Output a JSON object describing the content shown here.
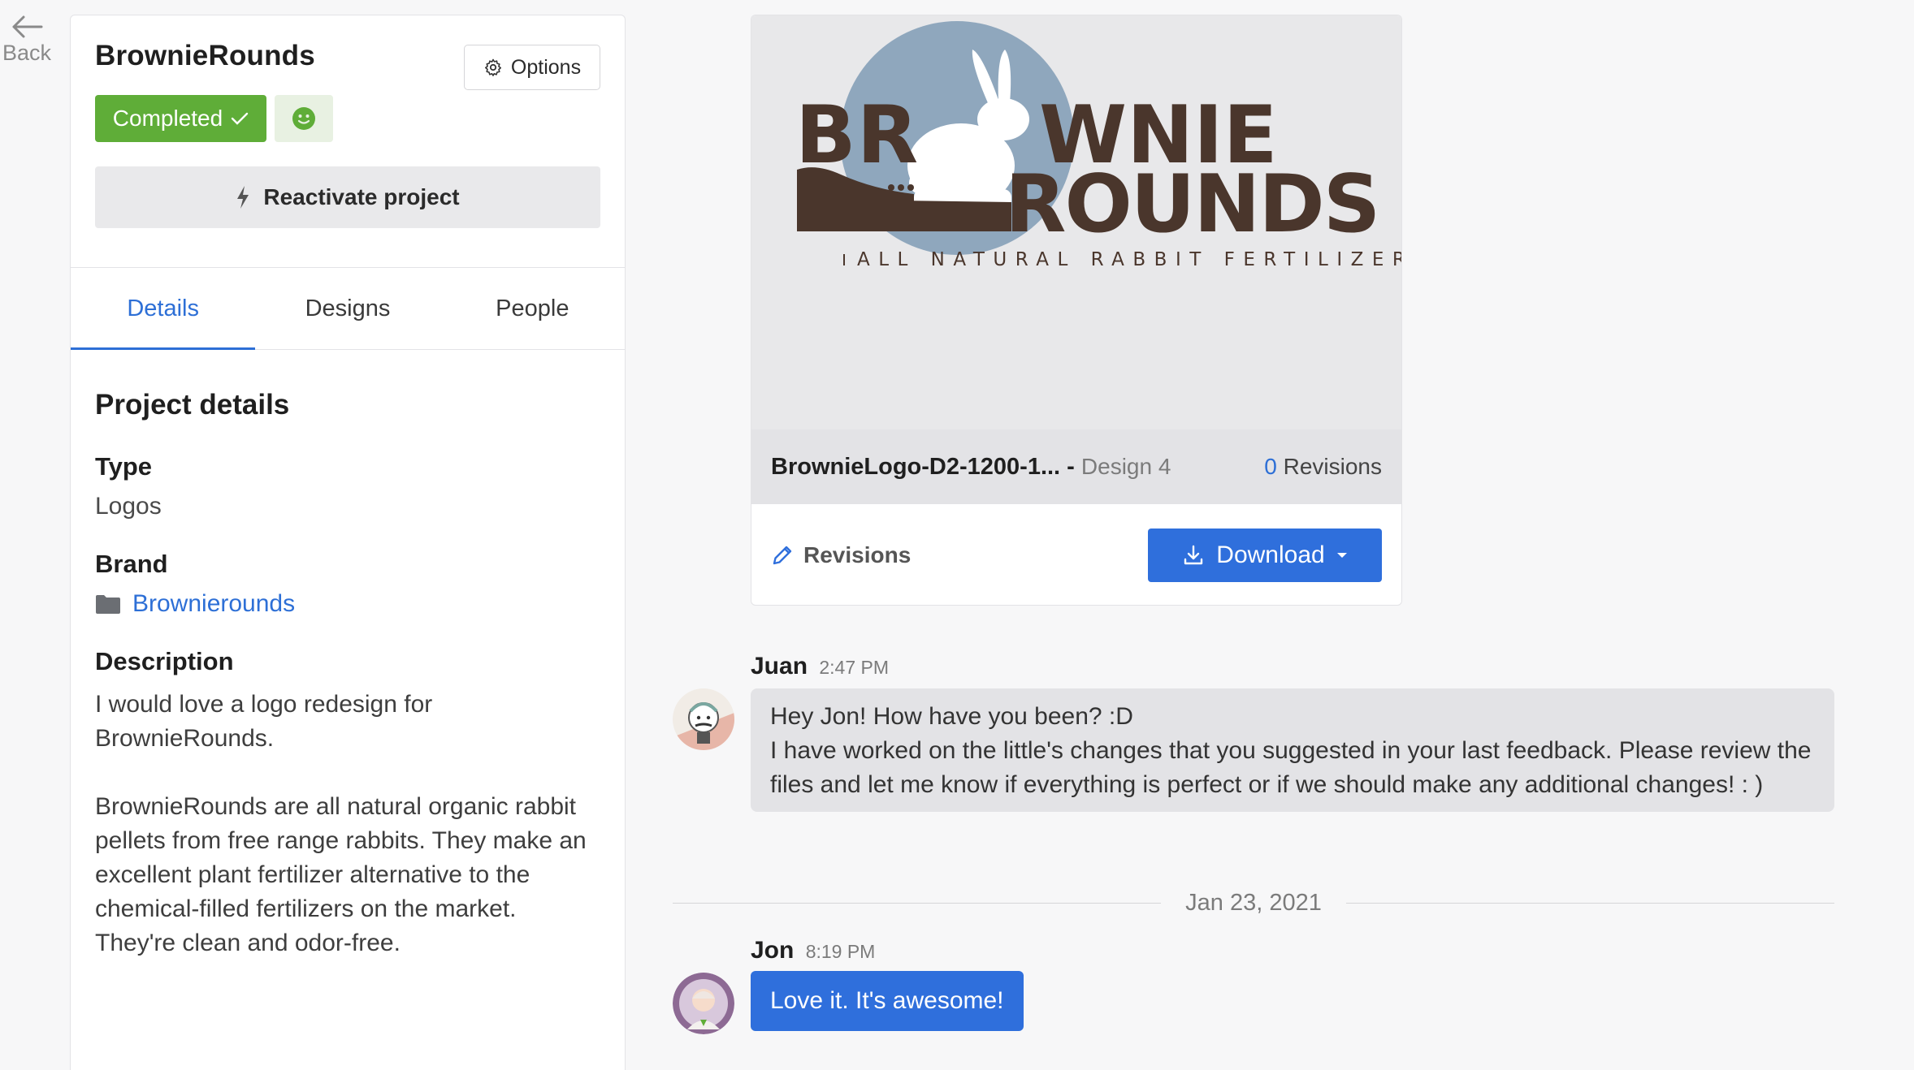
{
  "nav": {
    "back_label": "Back"
  },
  "project": {
    "title": "BrownieRounds",
    "options_label": "Options",
    "status_label": "Completed",
    "reactivate_label": "Reactivate project"
  },
  "tabs": [
    {
      "label": "Details",
      "active": true
    },
    {
      "label": "Designs",
      "active": false
    },
    {
      "label": "People",
      "active": false
    }
  ],
  "details": {
    "heading": "Project details",
    "type_label": "Type",
    "type_value": "Logos",
    "brand_label": "Brand",
    "brand_value": "Brownierounds",
    "description_label": "Description",
    "description_paragraphs": [
      "I would love a logo redesign for BrownieRounds.",
      "BrownieRounds are all natural organic rabbit pellets from free range rabbits. They make an excellent plant fertilizer alternative to the chemical-filled fertilizers on the market. They're clean and odor-free."
    ]
  },
  "design": {
    "logo_line1_left": "BR",
    "logo_line1_right": "WNIE",
    "logo_line2": "ROUNDS",
    "logo_tagline": "ALL NATURAL RABBIT FERTILIZER",
    "filename": "BrownieLogo-D2-1200-1...",
    "separator": " - ",
    "design_number": "Design 4",
    "revisions_count": "0",
    "revisions_count_label": "Revisions",
    "revisions_link_label": "Revisions",
    "download_label": "Download"
  },
  "messages": [
    {
      "author": "Juan",
      "time": "2:47 PM",
      "lines": [
        "Hey Jon! How have you been? :D",
        "I have worked on the little's changes that you suggested in your last feedback. Please review the files and let me know if everything is perfect or if we should make any additional changes! : )"
      ]
    },
    {
      "author": "Jon",
      "time": "8:19 PM",
      "lines": [
        "Love it. It's awesome!"
      ]
    }
  ],
  "date_separator": "Jan 23, 2021",
  "colors": {
    "accent_blue": "#2f6fdc",
    "status_green": "#5fad38",
    "logo_brown": "#4a362c",
    "logo_moon": "#8fa7bd"
  }
}
